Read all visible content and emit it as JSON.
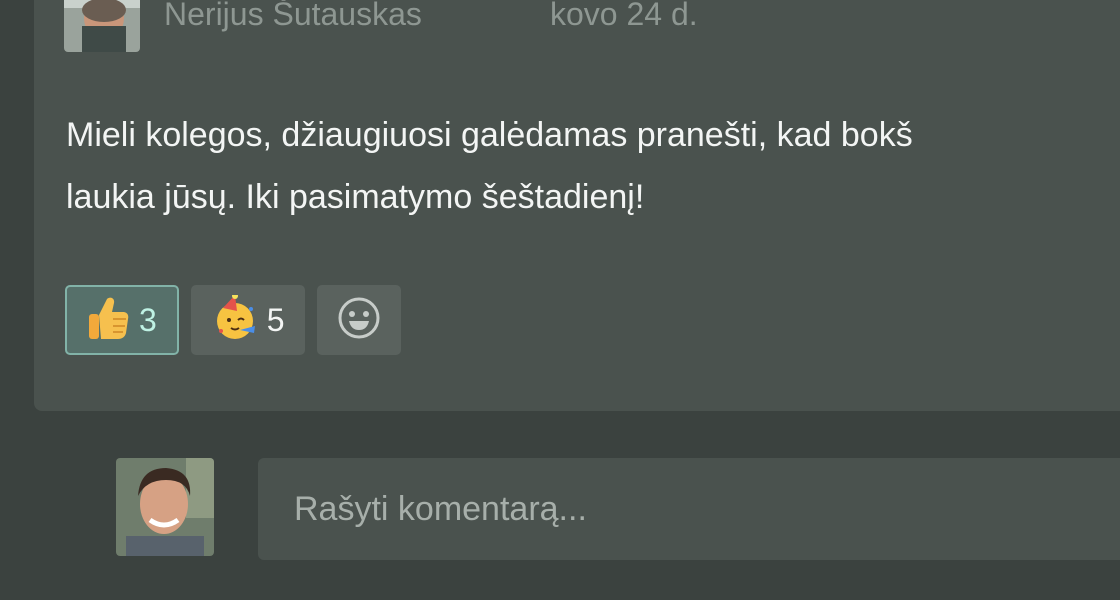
{
  "post": {
    "author_name": "Nerijus Šutauskas",
    "date": "kovo 24 d.",
    "body_line_1": "Mieli kolegos, džiaugiuosi galėdamas pranešti, kad bokš",
    "body_line_2": "laukia jūsų. Iki pasimatymo šeštadienį!"
  },
  "reactions": [
    {
      "icon": "thumbs-up-icon",
      "count": "3",
      "active": true
    },
    {
      "icon": "party-face-icon",
      "count": "5",
      "active": false
    }
  ],
  "add_reaction_icon": "smiley-icon",
  "comment": {
    "placeholder": "Rašyti komentarą..."
  },
  "colors": {
    "background": "#3b423f",
    "card": "#4a524e",
    "active_reaction_border": "#82b3a8",
    "active_reaction_text": "#bff2e4"
  }
}
